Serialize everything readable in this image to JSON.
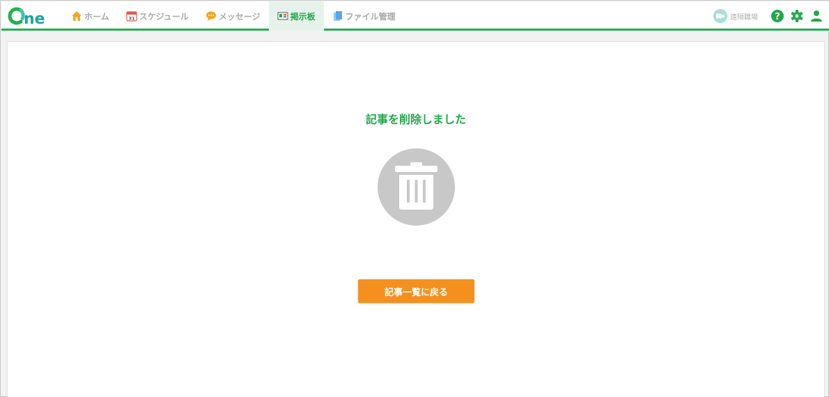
{
  "app": {
    "logo_text": "One",
    "brand_color": "#22b14c",
    "accent_color": "#f5901f"
  },
  "nav": {
    "items": [
      {
        "label": "ホーム",
        "icon": "home-icon",
        "active": false
      },
      {
        "label": "スケジュール",
        "icon": "calendar-icon",
        "active": false
      },
      {
        "label": "メッセージ",
        "icon": "message-icon",
        "active": false
      },
      {
        "label": "掲示板",
        "icon": "bulletin-board-icon",
        "active": true
      },
      {
        "label": "ファイル管理",
        "icon": "file-icon",
        "active": false
      }
    ]
  },
  "tools": {
    "remote_label": "遠隔職場",
    "icons": [
      "video-camera-icon",
      "help-icon",
      "gear-icon",
      "user-icon"
    ]
  },
  "main": {
    "message": "記事を削除しました",
    "status_icon": "trash-icon",
    "back_button_label": "記事一覧に戻る"
  }
}
